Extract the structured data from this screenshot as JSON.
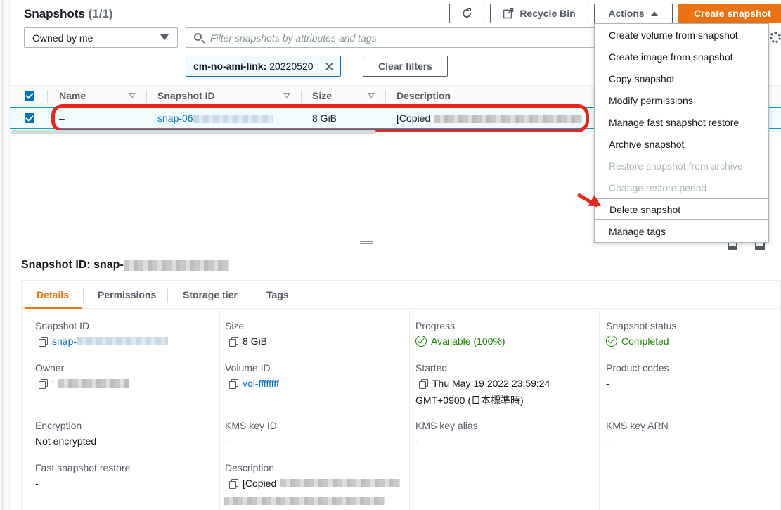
{
  "header": {
    "title": "Snapshots",
    "count": "(1/1)",
    "recycle_bin": "Recycle Bin",
    "actions": "Actions",
    "create_snapshot": "Create snapshot"
  },
  "filter": {
    "owner_select": "Owned by me",
    "search_placeholder": "Filter snapshots by attributes and tags",
    "token_key": "cm-no-ami-link:",
    "token_value": "20220520",
    "clear_filters": "Clear filters"
  },
  "table": {
    "columns": [
      "Name",
      "Snapshot ID",
      "Size",
      "Description"
    ],
    "rows": [
      {
        "name": "–",
        "snapshot_id": "snap-06",
        "size": "8 GiB",
        "description": "[Copied"
      }
    ]
  },
  "actions_menu": {
    "items": [
      {
        "label": "Create volume from snapshot",
        "enabled": true
      },
      {
        "label": "Create image from snapshot",
        "enabled": true
      },
      {
        "label": "Copy snapshot",
        "enabled": true
      },
      {
        "label": "Modify permissions",
        "enabled": true
      },
      {
        "label": "Manage fast snapshot restore",
        "enabled": true
      },
      {
        "label": "Archive snapshot",
        "enabled": true
      },
      {
        "label": "Restore snapshot from archive",
        "enabled": false
      },
      {
        "label": "Change restore period",
        "enabled": false
      },
      {
        "label": "Delete snapshot",
        "enabled": true
      },
      {
        "label": "Manage tags",
        "enabled": true
      }
    ]
  },
  "details": {
    "title": "Snapshot ID: snap-",
    "tabs": [
      "Details",
      "Permissions",
      "Storage tier",
      "Tags"
    ],
    "fields": {
      "snapshot_id_label": "Snapshot ID",
      "snapshot_id_value": "snap-",
      "size_label": "Size",
      "size_value": "8 GiB",
      "progress_label": "Progress",
      "progress_value": "Available (100%)",
      "status_label": "Snapshot status",
      "status_value": "Completed",
      "owner_label": "Owner",
      "owner_value": "'",
      "volume_label": "Volume ID",
      "volume_value": "vol-ffffffff",
      "started_label": "Started",
      "started_value_line1": "Thu May 19 2022 23:59:24",
      "started_value_line2": "GMT+0900 (日本標準時)",
      "product_codes_label": "Product codes",
      "product_codes_value": "-",
      "encryption_label": "Encryption",
      "encryption_value": "Not encrypted",
      "kms_key_id_label": "KMS key ID",
      "kms_key_id_value": "-",
      "kms_key_alias_label": "KMS key alias",
      "kms_key_alias_value": "-",
      "kms_key_arn_label": "KMS key ARN",
      "kms_key_arn_value": "-",
      "fast_restore_label": "Fast snapshot restore",
      "fast_restore_value": "-",
      "description_label": "Description",
      "description_value": "[Copied"
    }
  },
  "colors": {
    "primary": "#ec7211",
    "link": "#0073bb",
    "success": "#1d8102",
    "highlight": "#e8261a"
  }
}
